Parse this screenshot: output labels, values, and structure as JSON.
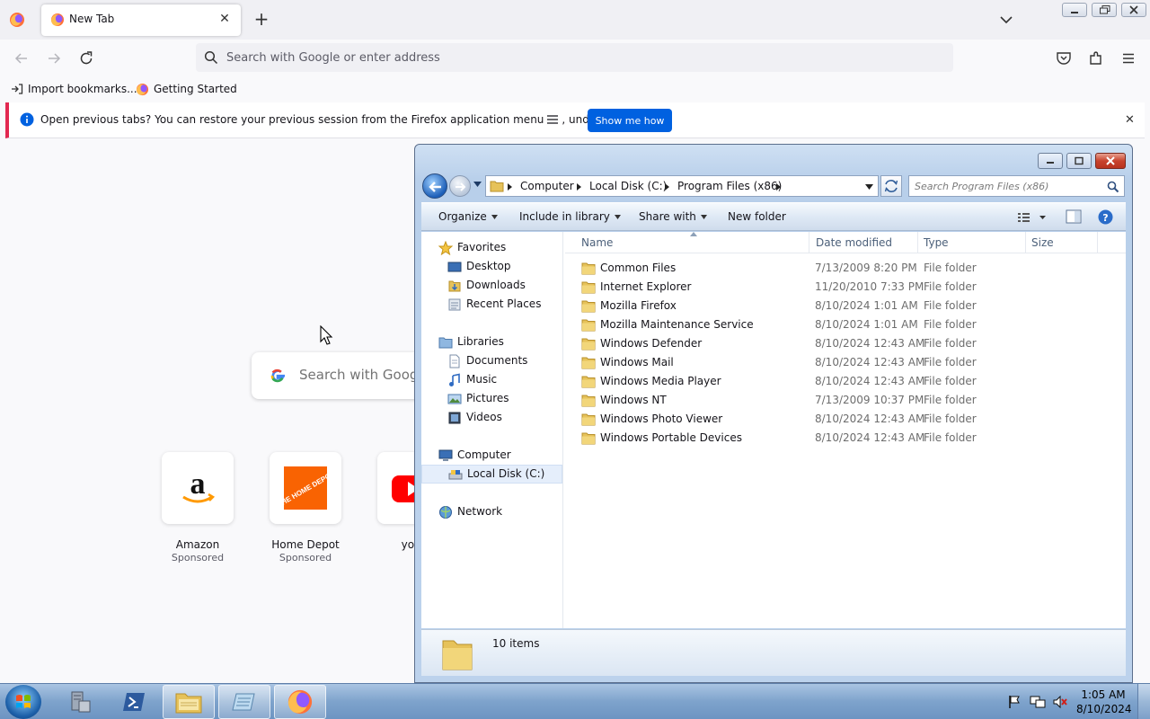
{
  "firefox": {
    "tab": {
      "title": "New Tab",
      "close_glyph": "✕"
    },
    "new_tab_glyph": "+",
    "urlbar": {
      "placeholder": "Search with Google or enter address"
    },
    "bookmarks": [
      {
        "label": "Import bookmarks...",
        "icon": "import-icon"
      },
      {
        "label": "Getting Started",
        "icon": "firefox-icon"
      }
    ],
    "notification": {
      "message_before": "Open previous tabs? You can restore your previous session from the Firefox application menu",
      "message_after": ", under History.",
      "button_label": "Show me how",
      "close_glyph": "✕"
    },
    "newtab": {
      "search_placeholder": "Search with Google",
      "tiles": [
        {
          "label": "Amazon",
          "sub": "Sponsored"
        },
        {
          "label": "Home Depot",
          "sub": "Sponsored"
        },
        {
          "label": "yout",
          "sub": ""
        }
      ],
      "home_depot_logo_text": "THE HOME DEPOT"
    },
    "colors": {
      "accent": "#0061e0",
      "notification_bar": "#e22850"
    }
  },
  "explorer": {
    "breadcrumb": [
      "Computer",
      "Local Disk (C:)",
      "Program Files (x86)"
    ],
    "search_placeholder": "Search Program Files (x86)",
    "toolbar": {
      "organize": "Organize",
      "include_in_library": "Include in library",
      "share_with": "Share with",
      "new_folder": "New folder"
    },
    "nav": {
      "favorites": "Favorites",
      "favorites_items": [
        "Desktop",
        "Downloads",
        "Recent Places"
      ],
      "libraries": "Libraries",
      "libraries_items": [
        "Documents",
        "Music",
        "Pictures",
        "Videos"
      ],
      "computer": "Computer",
      "computer_items": [
        "Local Disk (C:)"
      ],
      "network": "Network"
    },
    "columns": [
      "Name",
      "Date modified",
      "Type",
      "Size"
    ],
    "files": [
      {
        "name": "Common Files",
        "date": "7/13/2009 8:20 PM",
        "type": "File folder"
      },
      {
        "name": "Internet Explorer",
        "date": "11/20/2010 7:33 PM",
        "type": "File folder"
      },
      {
        "name": "Mozilla Firefox",
        "date": "8/10/2024 1:01 AM",
        "type": "File folder"
      },
      {
        "name": "Mozilla Maintenance Service",
        "date": "8/10/2024 1:01 AM",
        "type": "File folder"
      },
      {
        "name": "Windows Defender",
        "date": "8/10/2024 12:43 AM",
        "type": "File folder"
      },
      {
        "name": "Windows Mail",
        "date": "8/10/2024 12:43 AM",
        "type": "File folder"
      },
      {
        "name": "Windows Media Player",
        "date": "8/10/2024 12:43 AM",
        "type": "File folder"
      },
      {
        "name": "Windows NT",
        "date": "7/13/2009 10:37 PM",
        "type": "File folder"
      },
      {
        "name": "Windows Photo Viewer",
        "date": "8/10/2024 12:43 AM",
        "type": "File folder"
      },
      {
        "name": "Windows Portable Devices",
        "date": "8/10/2024 12:43 AM",
        "type": "File folder"
      }
    ],
    "status": "10 items"
  },
  "taskbar": {
    "clock_time": "1:05 AM",
    "clock_date": "8/10/2024"
  }
}
